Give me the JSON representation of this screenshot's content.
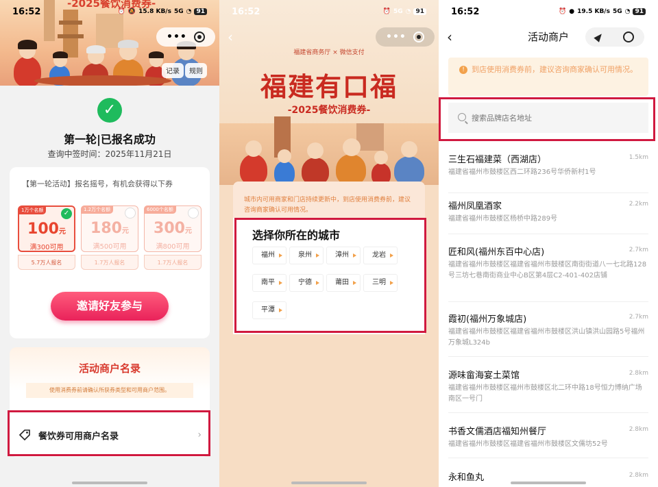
{
  "status": {
    "time": "16:52",
    "battery": "91",
    "net1": "15.8 KB/s",
    "net2": "19.5 KB/s",
    "sig": "5G"
  },
  "panel1": {
    "banner_title": "-2025餐饮消费券-",
    "record": "记录",
    "rules": "规则",
    "round": "第一轮|已报名成功",
    "query_time": "查询中签时间：2025年11月21日",
    "hint": "【第一轮活动】报名摇号，有机会获得以下券",
    "coupons": [
      {
        "quota": "1万个名额",
        "amount": "100",
        "unit": "元",
        "cond": "满300可用",
        "regs": "5.7万人报名",
        "selected": true
      },
      {
        "quota": "1.2万个名额",
        "amount": "180",
        "unit": "元",
        "cond": "满500可用",
        "regs": "1.7万人报名",
        "selected": false
      },
      {
        "quota": "6000个名额",
        "amount": "300",
        "unit": "元",
        "cond": "满800可用",
        "regs": "1.7万人报名",
        "selected": false
      }
    ],
    "invite": "邀请好友参与",
    "merchant_title": "活动商户名录",
    "merchant_note": "使用消费券前请确认所获券类型和可用商户范围。",
    "merchant_row": "餐饮券可用商户名录"
  },
  "panel2": {
    "org": "福建省商务厅 × 微信支付",
    "big": "福建有口福",
    "sub": "-2025餐饮消费券-",
    "notice": "城市内可用商家和门店持续更新中，到店使用消费券前，建议咨询商家确认可用情况。",
    "choose": "选择你所在的城市",
    "cities": [
      "福州",
      "泉州",
      "漳州",
      "龙岩",
      "南平",
      "宁德",
      "莆田",
      "三明",
      "平潭"
    ]
  },
  "panel3": {
    "title": "活动商户",
    "notice": "到店使用消费券前，建议咨询商家确认可用情况。",
    "search_placeholder": "搜索品牌店名地址",
    "merchants": [
      {
        "name": "三生石福建菜（西湖店）",
        "dist": "1.5km",
        "addr": "福建省福州市鼓楼区西二环路236号华侨新村1号"
      },
      {
        "name": "福州凤凰酒家",
        "dist": "2.2km",
        "addr": "福建省福州市鼓楼区杨桥中路289号"
      },
      {
        "name": "匠和风(福州东百中心店)",
        "dist": "2.7km",
        "addr": "福建省福州市鼓楼区福建省福州市鼓楼区南街街道八一七北路128号三坊七巷南街商业中心B区第4层C2-401-402店铺"
      },
      {
        "name": "霞初(福州万象城店)",
        "dist": "2.7km",
        "addr": "福建省福州市鼓楼区福建省福州市鼓楼区洪山镇洪山园路5号福州万象城L324b"
      },
      {
        "name": "源味畲海宴土菜馆",
        "dist": "2.8km",
        "addr": "福建省福州市鼓楼区福州市鼓楼区北二环中路18号恒力博纳广场南区一号门"
      },
      {
        "name": "书香文儒酒店福知州餐厅",
        "dist": "2.8km",
        "addr": "福建省福州市鼓楼区福建省福州市鼓楼区文儒坊52号"
      },
      {
        "name": "永和鱼丸",
        "dist": "2.8km",
        "addr": ""
      }
    ]
  }
}
